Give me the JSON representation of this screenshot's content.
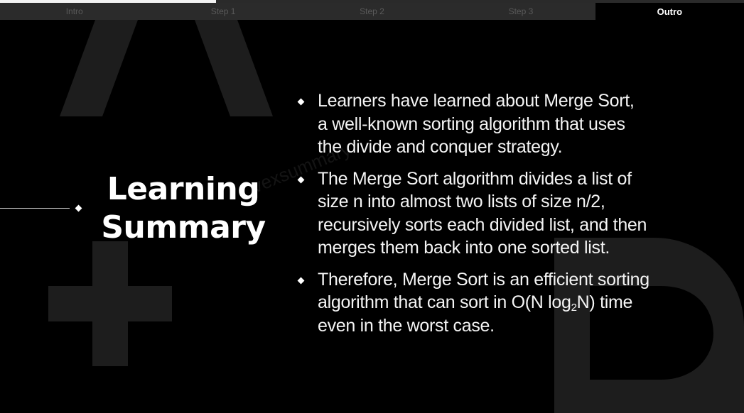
{
  "progress": {
    "fraction": 0.29
  },
  "nav": {
    "tabs": [
      {
        "label": "Intro",
        "active": false
      },
      {
        "label": "Step 1",
        "active": false
      },
      {
        "label": "Step 2",
        "active": false
      },
      {
        "label": "Step 3",
        "active": false
      },
      {
        "label": "Outro",
        "active": true
      }
    ]
  },
  "title": {
    "line1": "Learning",
    "line2": "Summary"
  },
  "watermark": "vexsummary",
  "summary": {
    "items": [
      {
        "lines": [
          "Learners have learned about Merge Sort,",
          "a well-known sorting algorithm that uses",
          "the divide and conquer strategy."
        ]
      },
      {
        "lines": [
          "The Merge Sort algorithm divides a list of",
          "size n into almost two lists of size n/2,",
          "recursively sorts each divided list, and then",
          "merges them back into one sorted list."
        ]
      },
      {
        "lines": [
          "Therefore, Merge Sort is an efficient sorting"
        ],
        "complexity": {
          "prefix": "algorithm that can sort in O(N log",
          "subscript": "2",
          "suffix": "N) time"
        },
        "last_line": "even in the worst case."
      }
    ]
  },
  "colors": {
    "background": "#000000",
    "tab_inactive": "#2b2b2b",
    "tab_inactive_text": "#5a5a5a",
    "text": "#ffffff",
    "decoration": "#1d1d1d"
  }
}
